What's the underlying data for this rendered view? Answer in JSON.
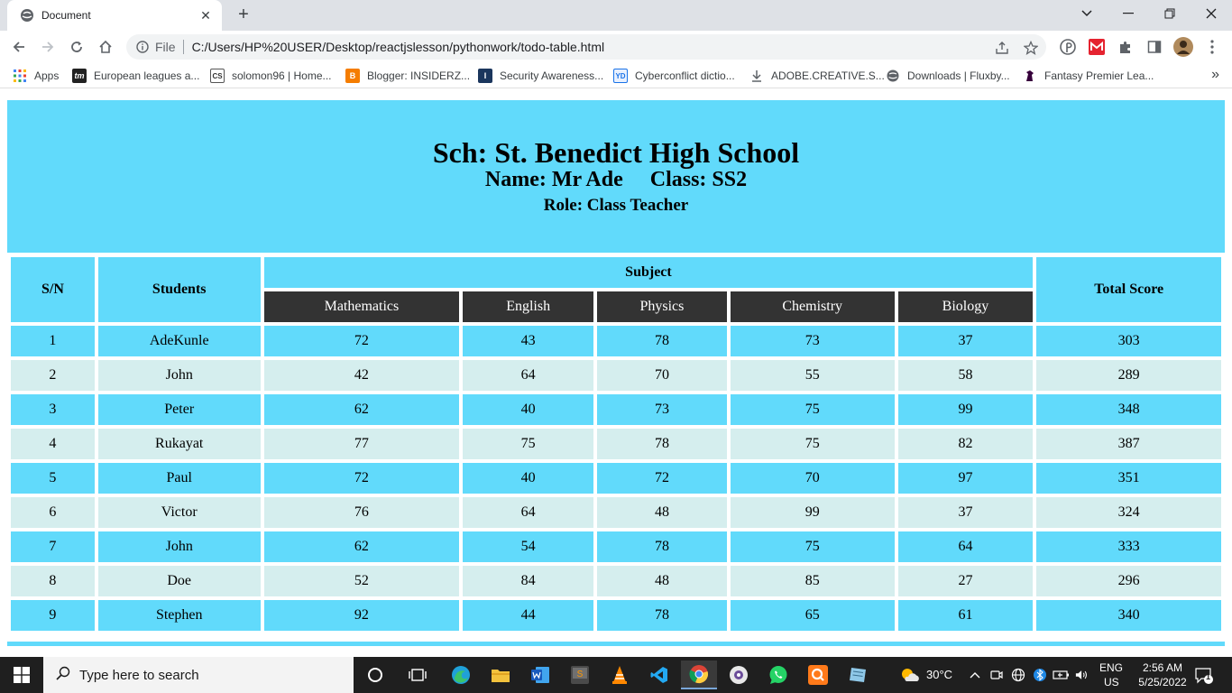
{
  "browser": {
    "tab_title": "Document",
    "tab_close": "✕",
    "new_tab": "+",
    "omnibox_scheme": "File",
    "url": "C:/Users/HP%20USER/Desktop/reactjslesson/pythonwork/todo-table.html"
  },
  "bookmarks": [
    {
      "label": "Apps",
      "icon": "apps-grid-icon"
    },
    {
      "label": "European leagues a...",
      "icon": "tm-icon"
    },
    {
      "label": "solomon96 | Home...",
      "icon": "cs-icon"
    },
    {
      "label": "Blogger: INSIDERZ...",
      "icon": "blogger-icon"
    },
    {
      "label": "Security Awareness...",
      "icon": "i-icon"
    },
    {
      "label": "Cyberconflict dictio...",
      "icon": "yd-icon"
    },
    {
      "label": "ADOBE.CREATIVE.S...",
      "icon": "download-icon"
    },
    {
      "label": "Downloads | Fluxby...",
      "icon": "globe-icon"
    },
    {
      "label": "Fantasy Premier Lea...",
      "icon": "premier-league-icon"
    }
  ],
  "banner": {
    "school": "Sch: St. Benedict High School",
    "name_class": "Name: Mr Ade     Class: SS2",
    "role": "Role: Class Teacher"
  },
  "table": {
    "headers": {
      "sn": "S/N",
      "students": "Students",
      "subject": "Subject",
      "total": "Total Score",
      "subjects": [
        "Mathematics",
        "English",
        "Physics",
        "Chemistry",
        "Biology"
      ]
    },
    "rows": [
      {
        "sn": "1",
        "name": "AdeKunle",
        "scores": [
          "72",
          "43",
          "78",
          "73",
          "37"
        ],
        "total": "303"
      },
      {
        "sn": "2",
        "name": "John",
        "scores": [
          "42",
          "64",
          "70",
          "55",
          "58"
        ],
        "total": "289"
      },
      {
        "sn": "3",
        "name": "Peter",
        "scores": [
          "62",
          "40",
          "73",
          "75",
          "99"
        ],
        "total": "348"
      },
      {
        "sn": "4",
        "name": "Rukayat",
        "scores": [
          "77",
          "75",
          "78",
          "75",
          "82"
        ],
        "total": "387"
      },
      {
        "sn": "5",
        "name": "Paul",
        "scores": [
          "72",
          "40",
          "72",
          "70",
          "97"
        ],
        "total": "351"
      },
      {
        "sn": "6",
        "name": "Victor",
        "scores": [
          "76",
          "64",
          "48",
          "99",
          "37"
        ],
        "total": "324"
      },
      {
        "sn": "7",
        "name": "John",
        "scores": [
          "62",
          "54",
          "78",
          "75",
          "64"
        ],
        "total": "333"
      },
      {
        "sn": "8",
        "name": "Doe",
        "scores": [
          "52",
          "84",
          "48",
          "85",
          "27"
        ],
        "total": "296"
      },
      {
        "sn": "9",
        "name": "Stephen",
        "scores": [
          "92",
          "44",
          "78",
          "65",
          "61"
        ],
        "total": "340"
      }
    ]
  },
  "colors": {
    "accent": "#61dafb",
    "row_alt": "#d5eeee",
    "subheader": "#333333"
  },
  "taskbar": {
    "search_placeholder": "Type here to search",
    "weather": "30°C",
    "lang_top": "ENG",
    "lang_bottom": "US",
    "time": "2:56 AM",
    "date": "5/25/2022",
    "notification_count": "1"
  }
}
